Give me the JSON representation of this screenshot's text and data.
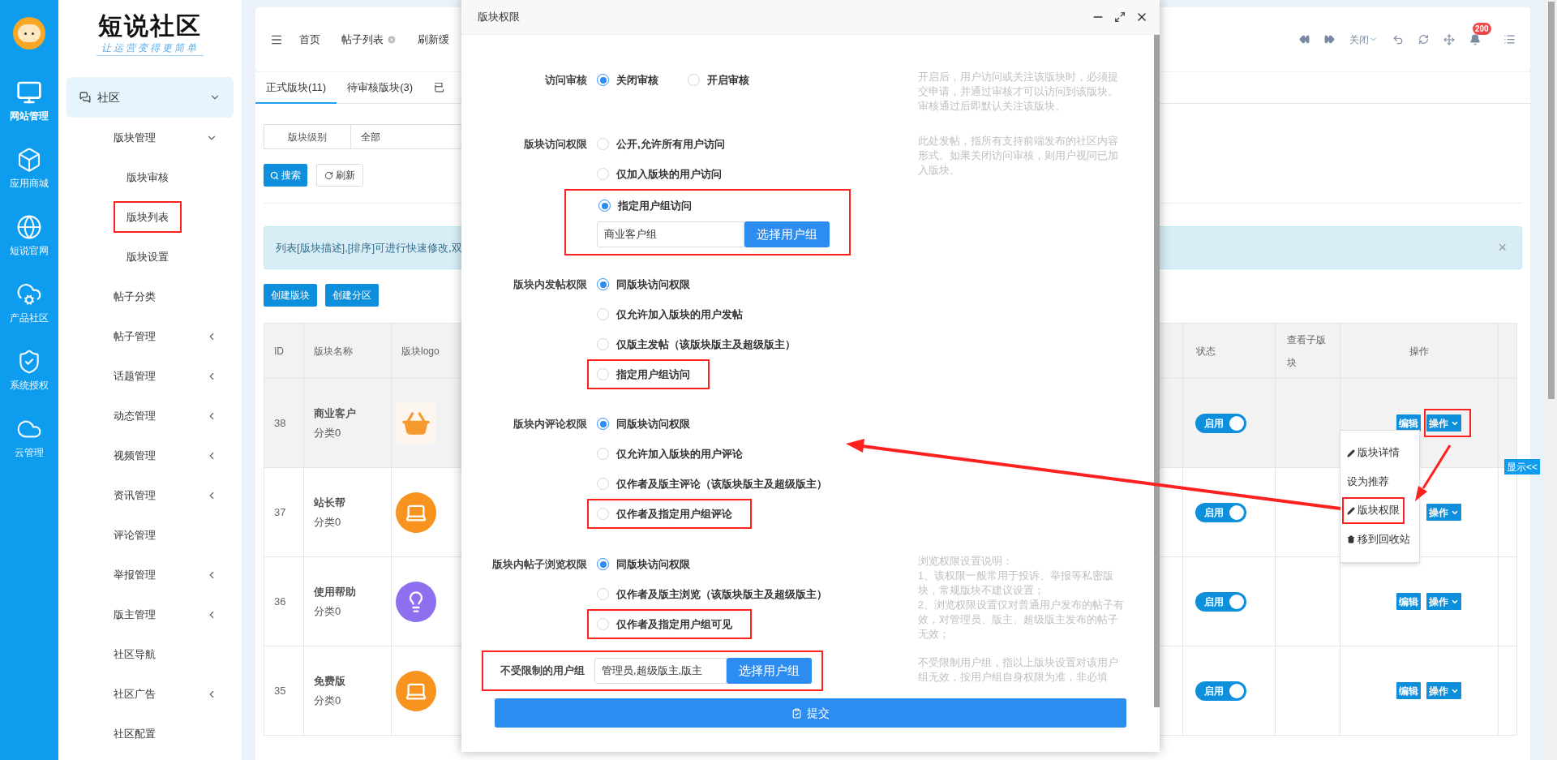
{
  "rail": {
    "items": [
      {
        "label": "网站管理",
        "selected": true
      },
      {
        "label": "应用商城",
        "selected": false
      },
      {
        "label": "短说官网",
        "selected": false
      },
      {
        "label": "产品社区",
        "selected": false
      },
      {
        "label": "系统授权",
        "selected": false
      },
      {
        "label": "云管理",
        "selected": false
      }
    ]
  },
  "brand": {
    "name": "短说社区",
    "slogan": "让运营变得更简单"
  },
  "sidebar": {
    "group": {
      "label": "社区",
      "expanded": true,
      "children": [
        {
          "label": "版块管理",
          "expanded": true,
          "children": [
            {
              "label": "版块审核",
              "annotated": false
            },
            {
              "label": "版块列表",
              "annotated": true
            },
            {
              "label": "版块设置",
              "annotated": false
            }
          ]
        },
        {
          "label": "帖子分类"
        },
        {
          "label": "帖子管理",
          "expanded": false
        },
        {
          "label": "话题管理",
          "expanded": false
        },
        {
          "label": "动态管理",
          "expanded": false
        },
        {
          "label": "视频管理",
          "expanded": false
        },
        {
          "label": "资讯管理",
          "expanded": false
        },
        {
          "label": "评论管理"
        },
        {
          "label": "举报管理",
          "expanded": false
        },
        {
          "label": "版主管理",
          "expanded": false
        },
        {
          "label": "社区导航"
        },
        {
          "label": "社区广告",
          "expanded": false
        },
        {
          "label": "社区配置"
        }
      ]
    }
  },
  "top_bar": {
    "tabs": [
      {
        "label": "首页",
        "closable": false
      },
      {
        "label": "帖子列表",
        "closable": true
      },
      {
        "label": "刷新缓",
        "closable": false
      }
    ],
    "close_menu": "关闭",
    "notification_count": "200"
  },
  "content": {
    "tabs": [
      {
        "label": "正式版块(11)",
        "selected": true
      },
      {
        "label": "待审核版块(3)",
        "selected": false
      },
      {
        "label": "已",
        "selected": false
      }
    ],
    "filter": {
      "label": "版块级别",
      "value": "全部"
    },
    "search_button": "搜索",
    "refresh_button": "刷新",
    "alert": {
      "text": "列表[版块描述],[排序]可进行快速修改,双",
      "close": "×"
    },
    "create_buttons": [
      "创建版块",
      "创建分区"
    ],
    "table": {
      "columns": [
        "ID",
        "版块名称",
        "版块logo",
        "状态",
        "查看子版块",
        "操作"
      ],
      "rows": [
        {
          "id": "38",
          "name": "商业客户",
          "category": "分类0",
          "logo": {
            "kind": "basket",
            "color": "#f59a2f"
          },
          "status": {
            "label": "启用",
            "on": true
          },
          "actions": [
            "编辑",
            "操作"
          ],
          "highlighted": true,
          "annotated": true
        },
        {
          "id": "37",
          "name": "站长帮",
          "category": "分类0",
          "logo": {
            "kind": "laptop",
            "color": "#f7931e"
          },
          "status": {
            "label": "启用",
            "on": true
          },
          "actions": [
            "操作"
          ],
          "highlighted": false,
          "annotated": false
        },
        {
          "id": "36",
          "name": "使用帮助",
          "category": "分类0",
          "logo": {
            "kind": "bulb",
            "color": "#8d6ff0"
          },
          "status": {
            "label": "启用",
            "on": true
          },
          "actions": [
            "编辑",
            "操作"
          ],
          "highlighted": false,
          "annotated": false
        },
        {
          "id": "35",
          "name": "免费版",
          "category": "分类0",
          "logo": {
            "kind": "laptop",
            "color": "#f7931e"
          },
          "status": {
            "label": "启用",
            "on": true
          },
          "actions": [
            "编辑",
            "操作"
          ],
          "highlighted": false,
          "annotated": false
        }
      ]
    }
  },
  "dropdown": {
    "items": [
      {
        "label": "版块详情",
        "kind": "pencil",
        "annotated": false
      },
      {
        "label": "设为推荐",
        "kind": "plain",
        "annotated": false
      },
      {
        "label": "版块权限",
        "kind": "pencil",
        "annotated": true
      },
      {
        "label": "移到回收站",
        "kind": "trash",
        "annotated": false
      }
    ]
  },
  "show_tab": "显示<<",
  "modal": {
    "title": "版块权限",
    "submit": "提交",
    "sections": [
      {
        "kind": "inline",
        "label": "访问审核",
        "options": [
          {
            "label": "关闭审核",
            "selected": true,
            "annotated": false
          },
          {
            "label": "开启审核",
            "selected": false,
            "annotated": false
          }
        ],
        "hint": [
          "开启后，用户访问或关注该版块时，必须提交申请，并通过审核才可以访问到该版块。审核通过后即默认关注该版块。"
        ]
      },
      {
        "kind": "stacked",
        "label": "版块访问权限",
        "options": [
          {
            "label": "公开,允许所有用户访问",
            "selected": false,
            "annotated": false
          },
          {
            "label": "仅加入版块的用户访问",
            "selected": false,
            "annotated": false
          },
          {
            "label": "指定用户组访问",
            "selected": true,
            "annotated": true,
            "field": {
              "value": "商业客户组",
              "button": "选择用户组"
            }
          }
        ],
        "hint": [
          "此处发帖，指所有支持前端发布的社区内容形式。如果关闭访问审核，则用户视同已加入版块。"
        ]
      },
      {
        "kind": "stacked",
        "label": "版块内发帖权限",
        "options": [
          {
            "label": "同版块访问权限",
            "selected": true,
            "annotated": false
          },
          {
            "label": "仅允许加入版块的用户发帖",
            "selected": false,
            "annotated": false
          },
          {
            "label": "仅版主发帖（该版块版主及超级版主）",
            "selected": false,
            "annotated": false
          },
          {
            "label": "指定用户组访问",
            "selected": false,
            "annotated": true
          }
        ]
      },
      {
        "kind": "stacked",
        "label": "版块内评论权限",
        "options": [
          {
            "label": "同版块访问权限",
            "selected": true,
            "annotated": false
          },
          {
            "label": "仅允许加入版块的用户评论",
            "selected": false,
            "annotated": false
          },
          {
            "label": "仅作者及版主评论（该版块版主及超级版主）",
            "selected": false,
            "annotated": false
          },
          {
            "label": "仅作者及指定用户组评论",
            "selected": false,
            "annotated": true
          }
        ]
      },
      {
        "kind": "stacked",
        "label": "版块内帖子浏览权限",
        "options": [
          {
            "label": "同版块访问权限",
            "selected": true,
            "annotated": false
          },
          {
            "label": "仅作者及版主浏览（该版块版主及超级版主）",
            "selected": false,
            "annotated": false
          },
          {
            "label": "仅作者及指定用户组可见",
            "selected": false,
            "annotated": true
          }
        ],
        "hint": [
          "浏览权限设置说明：",
          "1、该权限一般常用于投诉、举报等私密版块，常规版块不建议设置；",
          "2、浏览权限设置仅对普通用户发布的帖子有效，对管理员、版主、超级版主发布的帖子无效；"
        ]
      },
      {
        "kind": "field",
        "label": "不受限制的用户组",
        "annotated": true,
        "field": {
          "value": "管理员,超级版主,版主",
          "button": "选择用户组"
        },
        "hint": [
          "不受限制用户组，指以上版块设置对该用户组无效，按用户组自身权限为准，非必填"
        ]
      }
    ]
  }
}
